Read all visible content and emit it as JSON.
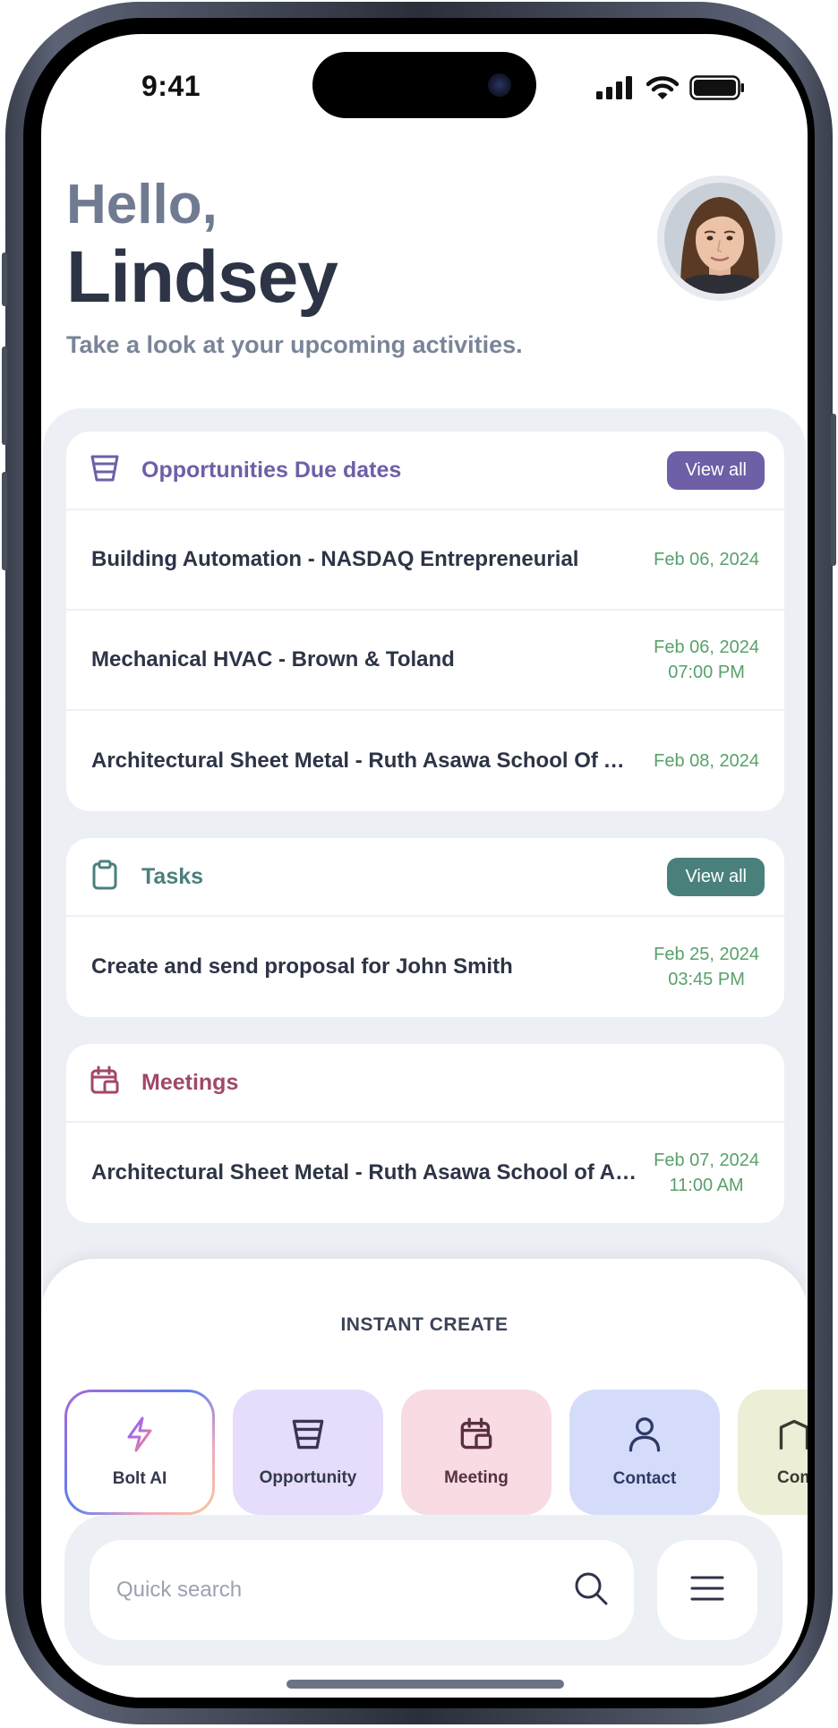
{
  "status_bar": {
    "time": "9:41"
  },
  "greeting": {
    "hello": "Hello,",
    "name": "Lindsey",
    "subtitle": "Take a look at your upcoming activities."
  },
  "opportunities": {
    "title": "Opportunities Due dates",
    "view_all": "View all",
    "accent": "#6e5fa6",
    "items": [
      {
        "label": "Building Automation - NASDAQ Entrepreneurial",
        "date": "Feb 06, 2024",
        "time": ""
      },
      {
        "label": "Mechanical HVAC - Brown & Toland",
        "date": "Feb 06, 2024",
        "time": "07:00 PM"
      },
      {
        "label": "Architectural Sheet Metal - Ruth Asawa School Of Arts",
        "date": "Feb 08, 2024",
        "time": ""
      }
    ]
  },
  "tasks": {
    "title": "Tasks",
    "view_all": "View all",
    "accent": "#4a807c",
    "items": [
      {
        "label": "Create and send proposal for John Smith",
        "date": "Feb 25, 2024",
        "time": "03:45 PM"
      }
    ]
  },
  "meetings": {
    "title": "Meetings",
    "accent": "#a0486a",
    "items": [
      {
        "label": "Architectural Sheet Metal - Ruth Asawa School of Arts",
        "date": "Feb 07, 2024",
        "time": "11:00 AM"
      }
    ]
  },
  "instant_create": {
    "title": "INSTANT CREATE",
    "items": [
      {
        "label": "Bolt AI",
        "icon": "bolt-icon",
        "bg": "#ffffff"
      },
      {
        "label": "Opportunity",
        "icon": "funnel-icon",
        "bg": "#e6dcfb"
      },
      {
        "label": "Meeting",
        "icon": "calendar-icon",
        "bg": "#f8dbe3"
      },
      {
        "label": "Contact",
        "icon": "person-icon",
        "bg": "#d5dcfa"
      },
      {
        "label": "Company",
        "icon": "building-icon",
        "bg": "#eceed6"
      }
    ]
  },
  "search": {
    "placeholder": "Quick search"
  },
  "colors": {
    "date_green": "#58a06a",
    "panel_bg": "#eceff4"
  }
}
